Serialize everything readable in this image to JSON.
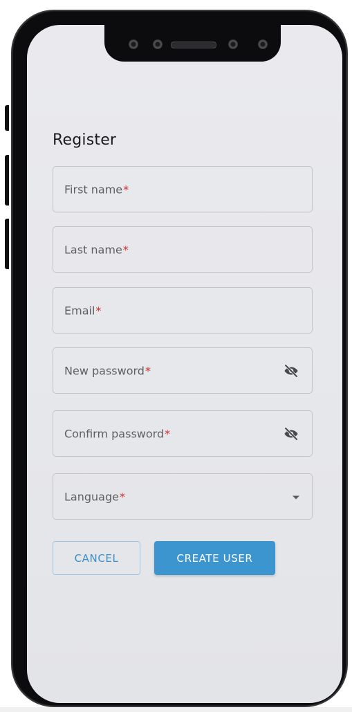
{
  "form": {
    "title": "Register",
    "fields": [
      {
        "label": "First name",
        "required_mark": "*"
      },
      {
        "label": "Last name",
        "required_mark": "*"
      },
      {
        "label": "Email",
        "required_mark": "*"
      },
      {
        "label": "New password",
        "required_mark": "*",
        "icon": "eye-off-icon"
      },
      {
        "label": "Confirm password",
        "required_mark": "*",
        "icon": "eye-off-icon"
      },
      {
        "label": "Language",
        "required_mark": "*",
        "icon": "chevron-down-icon"
      }
    ],
    "buttons": {
      "cancel_label": "CANCEL",
      "create_label": "CREATE USER"
    }
  },
  "colors": {
    "accent": "#3d95d0",
    "required": "#d32f2f",
    "screen_bg": "#e8e9ed",
    "frame": "#0c0c0e"
  }
}
